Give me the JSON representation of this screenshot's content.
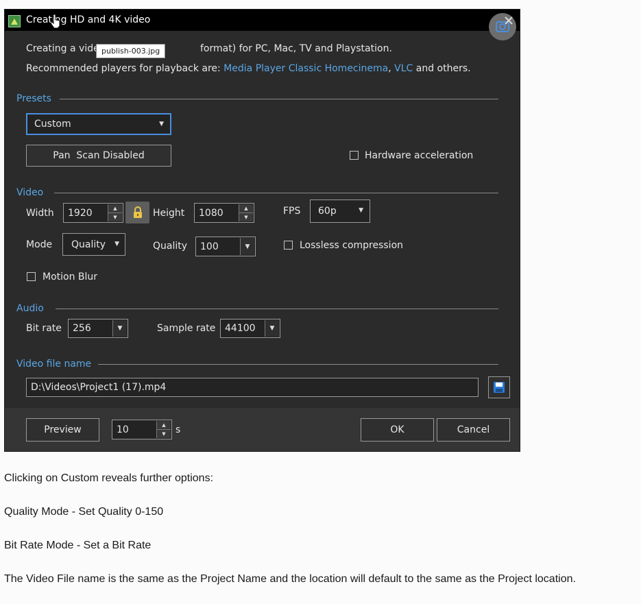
{
  "dialog": {
    "title": "Creating HD and 4K video",
    "intro_line1_pre": "Creating a vide",
    "intro_line1_post": "format) for PC, Mac, TV and Playstation.",
    "intro_line2_pre": "Recommended players for playback are: ",
    "link_mpc": "Media Player Classic Homecinema",
    "comma": ",",
    "link_vlc": "VLC",
    "intro_line2_post": " and others.",
    "tooltip": "publish-003.jpg",
    "presets": {
      "section_label": "Presets",
      "preset_value": "Custom",
      "pan_scan_label": "Pan  Scan Disabled",
      "hw_accel_label": "Hardware acceleration"
    },
    "video": {
      "section_label": "Video",
      "width_label": "Width",
      "width_value": "1920",
      "height_label": "Height",
      "height_value": "1080",
      "fps_label": "FPS",
      "fps_value": "60p",
      "mode_label": "Mode",
      "mode_value": "Quality",
      "quality_label": "Quality",
      "quality_value": "100",
      "lossless_label": "Lossless compression",
      "motion_blur_label": "Motion Blur"
    },
    "audio": {
      "section_label": "Audio",
      "bitrate_label": "Bit rate",
      "bitrate_value": "256",
      "samplerate_label": "Sample rate",
      "samplerate_value": "44100"
    },
    "file": {
      "section_label": "Video file name",
      "path_value": "D:\\Videos\\Project1 (17).mp4"
    },
    "footer": {
      "preview_label": "Preview",
      "duration_value": "10",
      "duration_unit": "s",
      "ok_label": "OK",
      "cancel_label": "Cancel"
    }
  },
  "doc": {
    "p1": "Clicking on Custom reveals further options:",
    "p2": "Quality Mode - Set Quality 0-150",
    "p3": "Bit Rate Mode - Set a Bit Rate",
    "p4": "The Video File name is the same as the Project Name and the location will default to the same as the Project location."
  },
  "colors": {
    "accent": "#5aa6e6",
    "dialog_bg": "#2b2b2b",
    "title_bg": "#000000",
    "footer_bg": "#353535"
  }
}
